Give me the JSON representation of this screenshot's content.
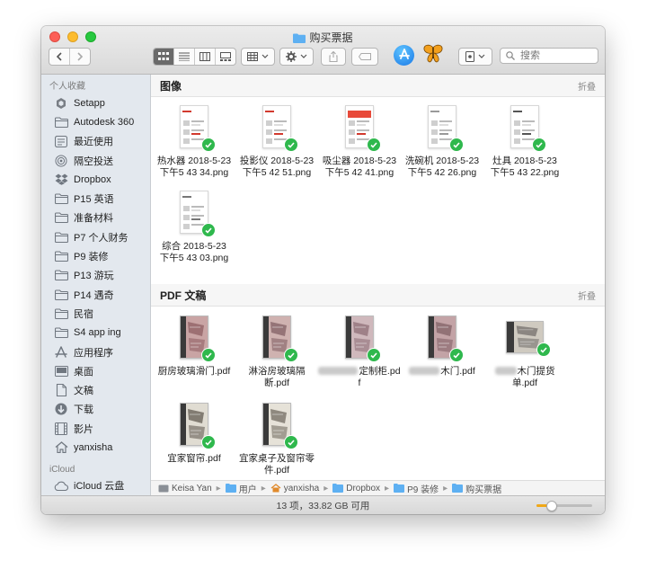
{
  "window": {
    "title": "购买票据"
  },
  "toolbar": {
    "search_placeholder": "搜索"
  },
  "sidebar": {
    "favorites_title": "个人收藏",
    "items": [
      {
        "label": "Setapp",
        "icon": "setapp-icon"
      },
      {
        "label": "Autodesk 360",
        "icon": "folder-icon"
      },
      {
        "label": "最近使用",
        "icon": "recents-icon"
      },
      {
        "label": "隔空投送",
        "icon": "airdrop-icon"
      },
      {
        "label": "Dropbox",
        "icon": "dropbox-icon"
      },
      {
        "label": "P15 英语",
        "icon": "folder-icon"
      },
      {
        "label": "准备材料",
        "icon": "folder-icon"
      },
      {
        "label": "P7 个人财务",
        "icon": "folder-icon"
      },
      {
        "label": "P9 装修",
        "icon": "folder-icon"
      },
      {
        "label": "P13 游玩",
        "icon": "folder-icon"
      },
      {
        "label": "P14 遇奇",
        "icon": "folder-icon"
      },
      {
        "label": "民宿",
        "icon": "folder-icon"
      },
      {
        "label": "S4 app ing",
        "icon": "folder-icon"
      },
      {
        "label": "应用程序",
        "icon": "applications-icon"
      },
      {
        "label": "桌面",
        "icon": "desktop-icon"
      },
      {
        "label": "文稿",
        "icon": "documents-icon"
      },
      {
        "label": "下载",
        "icon": "downloads-icon"
      },
      {
        "label": "影片",
        "icon": "movies-icon"
      },
      {
        "label": "yanxisha",
        "icon": "home-icon"
      }
    ],
    "icloud_title": "iCloud",
    "icloud_items": [
      {
        "label": "iCloud 云盘",
        "icon": "icloud-icon"
      }
    ]
  },
  "sections": {
    "images": {
      "title": "图像",
      "collapse_label": "折叠"
    },
    "pdfs": {
      "title": "PDF 文稿",
      "collapse_label": "折叠"
    }
  },
  "images": [
    {
      "line1": "热水器 2018-5-23",
      "line2": "下午5 43 34.png"
    },
    {
      "line1": "投影仪 2018-5-23",
      "line2": "下午5 42 51.png"
    },
    {
      "line1": "吸尘器 2018-5-23",
      "line2": "下午5 42 41.png"
    },
    {
      "line1": "洗碗机 2018-5-23",
      "line2": "下午5 42 26.png"
    },
    {
      "line1": "灶具 2018-5-23",
      "line2": "下午5 43 22.png"
    },
    {
      "line1": "综合 2018-5-23",
      "line2": "下午5 43 03.png"
    }
  ],
  "pdfs": [
    {
      "line1": "厨房玻璃滑门.pdf",
      "line2": ""
    },
    {
      "line1": "淋浴房玻璃隔",
      "line2": "断.pdf"
    },
    {
      "line1": "定制柜.pdf",
      "line2": ""
    },
    {
      "line1": "木门.pdf",
      "line2": ""
    },
    {
      "line1": "木门提货",
      "line2": "单.pdf"
    },
    {
      "line1": "宜家窗帘.pdf",
      "line2": ""
    },
    {
      "line1": "宜家桌子及窗帘零",
      "line2": "件.pdf"
    }
  ],
  "pathbar": {
    "crumbs": [
      "Keisa Yan",
      "用户",
      "yanxisha",
      "Dropbox",
      "P9 装修",
      "购买票据"
    ]
  },
  "status": {
    "text": "13 项，33.82 GB 可用"
  },
  "zoom": {
    "level": 0.25
  },
  "colors": {
    "sync_green": "#2fb84d",
    "folder_blue": "#5eb0f2",
    "slider_orange": "#f0a818"
  }
}
